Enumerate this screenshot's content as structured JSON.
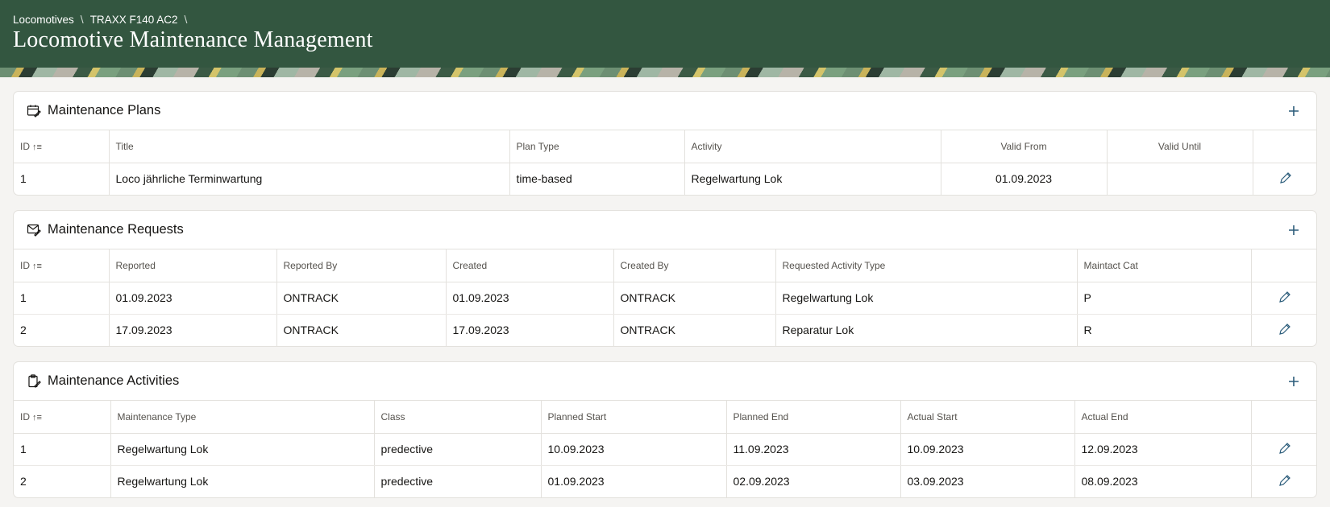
{
  "breadcrumb": [
    "Locomotives",
    "TRAXX F140 AC2"
  ],
  "title": "Locomotive Maintenance Management",
  "plans": {
    "title": "Maintenance Plans",
    "columns": [
      "ID",
      "Title",
      "Plan Type",
      "Activity",
      "Valid From",
      "Valid Until"
    ],
    "rows": [
      [
        "1",
        "Loco jährliche Terminwartung",
        "time-based",
        "Regelwartung Lok",
        "01.09.2023",
        ""
      ]
    ]
  },
  "requests": {
    "title": "Maintenance Requests",
    "columns": [
      "ID",
      "Reported",
      "Reported By",
      "Created",
      "Created By",
      "Requested Activity Type",
      "Maintact Cat"
    ],
    "rows": [
      [
        "1",
        "01.09.2023",
        "ONTRACK",
        "01.09.2023",
        "ONTRACK",
        "Regelwartung Lok",
        "P"
      ],
      [
        "2",
        "17.09.2023",
        "ONTRACK",
        "17.09.2023",
        "ONTRACK",
        "Reparatur Lok",
        "R"
      ]
    ]
  },
  "activities": {
    "title": "Maintenance Activities",
    "columns": [
      "ID",
      "Maintenance Type",
      "Class",
      "Planned Start",
      "Planned End",
      "Actual Start",
      "Actual End"
    ],
    "rows": [
      [
        "1",
        "Regelwartung Lok",
        "predective",
        "10.09.2023",
        "11.09.2023",
        "10.09.2023",
        "12.09.2023"
      ],
      [
        "2",
        "Regelwartung Lok",
        "predective",
        "01.09.2023",
        "02.09.2023",
        "03.09.2023",
        "08.09.2023"
      ]
    ]
  },
  "icons": {
    "plans": "calendar-edit-icon",
    "requests": "message-edit-icon",
    "activities": "clipboard-edit-icon",
    "add": "plus-icon",
    "edit": "pencil-icon",
    "sort": "sort-ascending-icon"
  },
  "colors": {
    "header": "#335640",
    "accent": "#2b5c7a"
  }
}
